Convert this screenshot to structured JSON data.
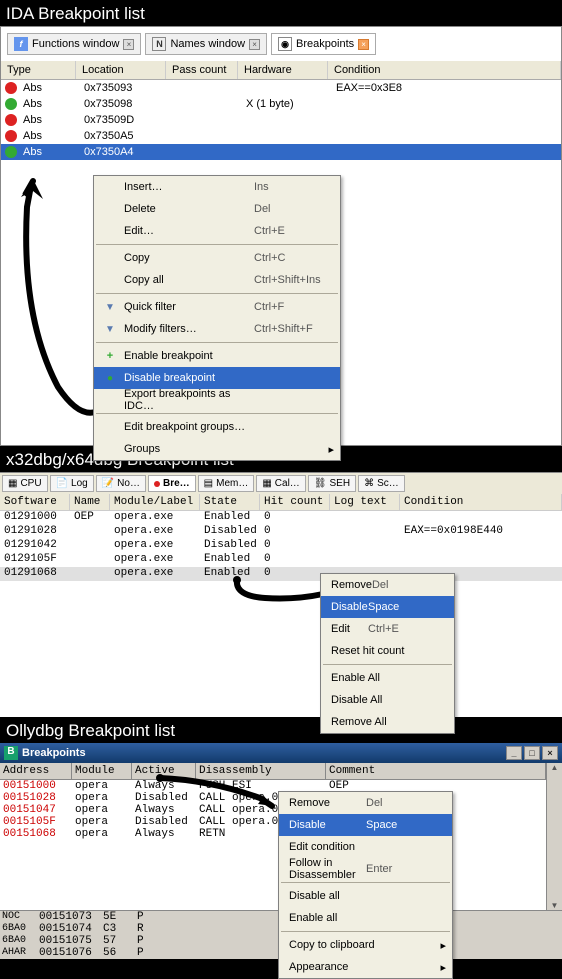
{
  "sections": {
    "ida_title": "IDA Breakpoint list",
    "xdbg_title": "x32dbg/x64dbg Breakpoint list",
    "olly_title": "Ollydbg Breakpoint list"
  },
  "ida": {
    "tabs": [
      {
        "label": "Functions window",
        "icon": "f"
      },
      {
        "label": "Names window",
        "icon": "n"
      },
      {
        "label": "Breakpoints",
        "icon": "b",
        "active": true
      }
    ],
    "headers": {
      "type": "Type",
      "location": "Location",
      "pass": "Pass count",
      "hardware": "Hardware",
      "condition": "Condition"
    },
    "rows": [
      {
        "dot": "red",
        "type": "Abs",
        "loc": "0x735093",
        "hw": "",
        "cond": "EAX==0x3E8"
      },
      {
        "dot": "green",
        "type": "Abs",
        "loc": "0x735098",
        "hw": "X (1 byte)",
        "cond": ""
      },
      {
        "dot": "red",
        "type": "Abs",
        "loc": "0x73509D",
        "hw": "",
        "cond": ""
      },
      {
        "dot": "red",
        "type": "Abs",
        "loc": "0x7350A5",
        "hw": "",
        "cond": ""
      },
      {
        "dot": "green",
        "type": "Abs",
        "loc": "0x7350A4",
        "hw": "",
        "cond": "",
        "selected": true
      }
    ],
    "menu": {
      "insert": "Insert…",
      "insert_sc": "Ins",
      "delete": "Delete",
      "delete_sc": "Del",
      "edit": "Edit…",
      "edit_sc": "Ctrl+E",
      "copy": "Copy",
      "copy_sc": "Ctrl+C",
      "copyall": "Copy all",
      "copyall_sc": "Ctrl+Shift+Ins",
      "quickfilter": "Quick filter",
      "quickfilter_sc": "Ctrl+F",
      "modifyfilters": "Modify filters…",
      "modifyfilters_sc": "Ctrl+Shift+F",
      "enable": "Enable breakpoint",
      "disable": "Disable breakpoint",
      "export": "Export breakpoints as IDC…",
      "editgroups": "Edit breakpoint groups…",
      "groups": "Groups"
    }
  },
  "xdbg": {
    "tabs": [
      {
        "label": "CPU",
        "icon": "cpu"
      },
      {
        "label": "Log",
        "icon": "log"
      },
      {
        "label": "No…",
        "icon": "notes"
      },
      {
        "label": "Bre…",
        "icon": "bp",
        "active": true
      },
      {
        "label": "Mem…",
        "icon": "mem"
      },
      {
        "label": "Cal…",
        "icon": "call"
      },
      {
        "label": "SEH",
        "icon": "seh"
      },
      {
        "label": "Sc…",
        "icon": "sc"
      }
    ],
    "headers": {
      "software": "Software",
      "name": "Name",
      "module": "Module/Label",
      "state": "State",
      "hit": "Hit count",
      "log": "Log text",
      "cond": "Condition"
    },
    "rows": [
      {
        "addr": "01291000",
        "name": "OEP",
        "mod": "opera.exe",
        "state": "Enabled",
        "hit": "0",
        "log": "",
        "cond": ""
      },
      {
        "addr": "01291028",
        "name": "",
        "mod": "opera.exe",
        "state": "Disabled",
        "hit": "0",
        "log": "",
        "cond": "EAX==0x0198E440"
      },
      {
        "addr": "01291042",
        "name": "",
        "mod": "opera.exe",
        "state": "Disabled",
        "hit": "0",
        "log": "",
        "cond": ""
      },
      {
        "addr": "0129105F",
        "name": "",
        "mod": "opera.exe",
        "state": "Enabled",
        "hit": "0",
        "log": "",
        "cond": ""
      },
      {
        "addr": "01291068",
        "name": "",
        "mod": "opera.exe",
        "state": "Enabled",
        "hit": "0",
        "log": "",
        "cond": "",
        "selected": true
      }
    ],
    "menu": {
      "remove": "Remove",
      "remove_sc": "Del",
      "disable": "Disable",
      "disable_sc": "Space",
      "edit": "Edit",
      "edit_sc": "Ctrl+E",
      "reset": "Reset hit count",
      "enableall": "Enable All",
      "disableall": "Disable All",
      "removeall": "Remove All"
    }
  },
  "olly": {
    "title": "Breakpoints",
    "headers": {
      "address": "Address",
      "module": "Module",
      "active": "Active",
      "disasm": "Disassembly",
      "comment": "Comment"
    },
    "rows": [
      {
        "addr": "00151000",
        "mod": "opera",
        "act": "Always",
        "dis": "PUSH ESI",
        "cmt": "OEP"
      },
      {
        "addr": "00151028",
        "mod": "opera",
        "act": "Disabled",
        "dis": "CALL opera.00151EE1",
        "cmt": ""
      },
      {
        "addr": "00151047",
        "mod": "opera",
        "act": "Always",
        "dis": "CALL opera.00",
        "cmt": ""
      },
      {
        "addr": "0015105F",
        "mod": "opera",
        "act": "Disabled",
        "dis": "CALL opera.00",
        "cmt": ""
      },
      {
        "addr": "00151068",
        "mod": "opera",
        "act": "Always",
        "dis": "RETN",
        "cmt": ""
      }
    ],
    "strip": [
      {
        "a": "00151073",
        "b": "5E",
        "c": "P"
      },
      {
        "a": "00151074",
        "b": "C3",
        "c": "R"
      },
      {
        "a": "00151075",
        "b": "57",
        "c": "P"
      },
      {
        "a": "00151076",
        "b": "56",
        "c": "P"
      }
    ],
    "strip_labels": {
      "l1": "NOC",
      "l2": "6BA0",
      "l3": "6BA0",
      "l4": "AHAR"
    },
    "menu": {
      "remove": "Remove",
      "remove_sc": "Del",
      "disable": "Disable",
      "disable_sc": "Space",
      "editcond": "Edit condition",
      "follow": "Follow in Disassembler",
      "follow_sc": "Enter",
      "disableall": "Disable all",
      "enableall": "Enable all",
      "copy": "Copy to clipboard",
      "appear": "Appearance"
    }
  }
}
